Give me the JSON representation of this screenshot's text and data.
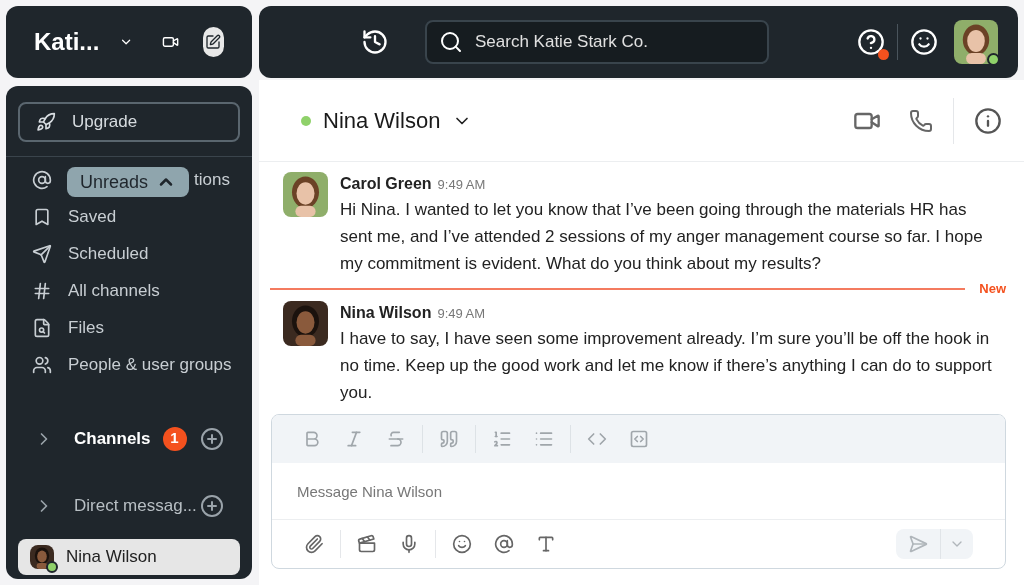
{
  "workspace": {
    "name": "Kati..."
  },
  "top_bar": {
    "search_placeholder": "Search Katie Stark Co.",
    "help_alert": true,
    "user_online": true
  },
  "sidebar": {
    "upgrade": "Upgrade",
    "unreads_pill": "Unreads",
    "items": [
      {
        "label": "tions"
      },
      {
        "label": "Saved"
      },
      {
        "label": "Scheduled"
      },
      {
        "label": "All channels"
      },
      {
        "label": "Files"
      },
      {
        "label": "People & user groups"
      }
    ],
    "sections": [
      {
        "label": "Channels",
        "unread": true,
        "badge": "1"
      },
      {
        "label": "Direct messag...",
        "unread": false
      }
    ],
    "dms": [
      {
        "name": "Nina Wilson",
        "selected": true,
        "online": true
      }
    ]
  },
  "conversation": {
    "name": "Nina Wilson",
    "online": true
  },
  "messages": [
    {
      "kind": "message",
      "author": "Carol Green",
      "time": "9:49 AM",
      "text": "Hi Nina. I wanted to let you know that I’ve been going through the materials HR has sent me, and I’ve attended 2 sessions of my anger management course so far. I hope my commitment is evident. What do you think about my results?"
    },
    {
      "kind": "divider",
      "label": "New"
    },
    {
      "kind": "message",
      "author": "Nina Wilson",
      "time": "9:49 AM",
      "text": "I have to say, I have seen some improvement already. I’m sure you’ll be off the hook in no time. Keep up the good work and let me know if there’s anything I can do to support you."
    }
  ],
  "composer": {
    "placeholder": "Message Nina Wilson"
  }
}
